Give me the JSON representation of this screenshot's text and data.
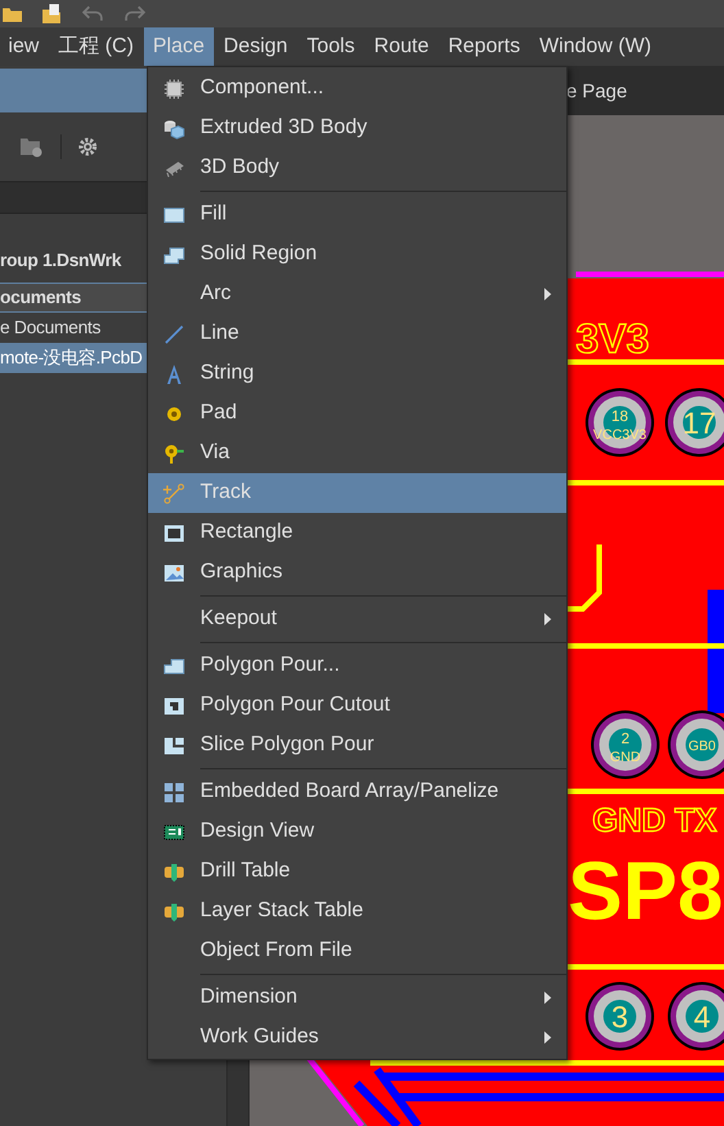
{
  "menu_bar": [
    {
      "label": "iew",
      "selected": false
    },
    {
      "label": "工程 (C)",
      "selected": false
    },
    {
      "label": "Place",
      "selected": true
    },
    {
      "label": "Design",
      "selected": false
    },
    {
      "label": "Tools",
      "selected": false
    },
    {
      "label": "Route",
      "selected": false
    },
    {
      "label": "Reports",
      "selected": false
    },
    {
      "label": "Window (W)",
      "selected": false
    }
  ],
  "projects_panel": {
    "items": [
      {
        "kind": "project",
        "label": "roup 1.DsnWrk",
        "selected": false
      },
      {
        "kind": "header",
        "label": "ocuments",
        "selected": false
      },
      {
        "kind": "folder",
        "label": "e Documents",
        "selected": false
      },
      {
        "kind": "file",
        "label": "mote-没电容.PcbD",
        "selected": true
      }
    ]
  },
  "document_tab": {
    "label": "e Page"
  },
  "place_menu": {
    "groups": [
      [
        {
          "label": "Component...",
          "submenu": false,
          "selected": false
        },
        {
          "label": "Extruded 3D Body",
          "submenu": false,
          "selected": false
        },
        {
          "label": "3D Body",
          "submenu": false,
          "selected": false
        }
      ],
      [
        {
          "label": "Fill",
          "submenu": false,
          "selected": false
        },
        {
          "label": "Solid Region",
          "submenu": false,
          "selected": false
        },
        {
          "label": "Arc",
          "submenu": true,
          "selected": false
        },
        {
          "label": "Line",
          "submenu": false,
          "selected": false
        },
        {
          "label": "String",
          "submenu": false,
          "selected": false
        },
        {
          "label": "Pad",
          "submenu": false,
          "selected": false
        },
        {
          "label": "Via",
          "submenu": false,
          "selected": false
        },
        {
          "label": "Track",
          "submenu": false,
          "selected": true
        },
        {
          "label": "Rectangle",
          "submenu": false,
          "selected": false
        },
        {
          "label": "Graphics",
          "submenu": false,
          "selected": false
        }
      ],
      [
        {
          "label": "Keepout",
          "submenu": true,
          "selected": false
        }
      ],
      [
        {
          "label": "Polygon Pour...",
          "submenu": false,
          "selected": false
        },
        {
          "label": "Polygon Pour Cutout",
          "submenu": false,
          "selected": false
        },
        {
          "label": "Slice Polygon Pour",
          "submenu": false,
          "selected": false
        }
      ],
      [
        {
          "label": "Embedded Board Array/Panelize",
          "submenu": false,
          "selected": false
        },
        {
          "label": "Design View",
          "submenu": false,
          "selected": false
        },
        {
          "label": "Drill Table",
          "submenu": false,
          "selected": false
        },
        {
          "label": "Layer Stack Table",
          "submenu": false,
          "selected": false
        },
        {
          "label": "Object From File",
          "submenu": false,
          "selected": false
        }
      ],
      [
        {
          "label": "Dimension",
          "submenu": true,
          "selected": false
        },
        {
          "label": "Work Guides",
          "submenu": true,
          "selected": false
        }
      ]
    ]
  },
  "board": {
    "labels": [
      "3V3",
      "GND TX",
      "SP8"
    ],
    "pads": [
      {
        "number": "18",
        "net": "VCC3V3"
      },
      {
        "number": "17"
      },
      {
        "number": "2",
        "net": "GND"
      },
      {
        "net": "GB0"
      },
      {
        "number": "3"
      },
      {
        "number": "4"
      }
    ]
  }
}
